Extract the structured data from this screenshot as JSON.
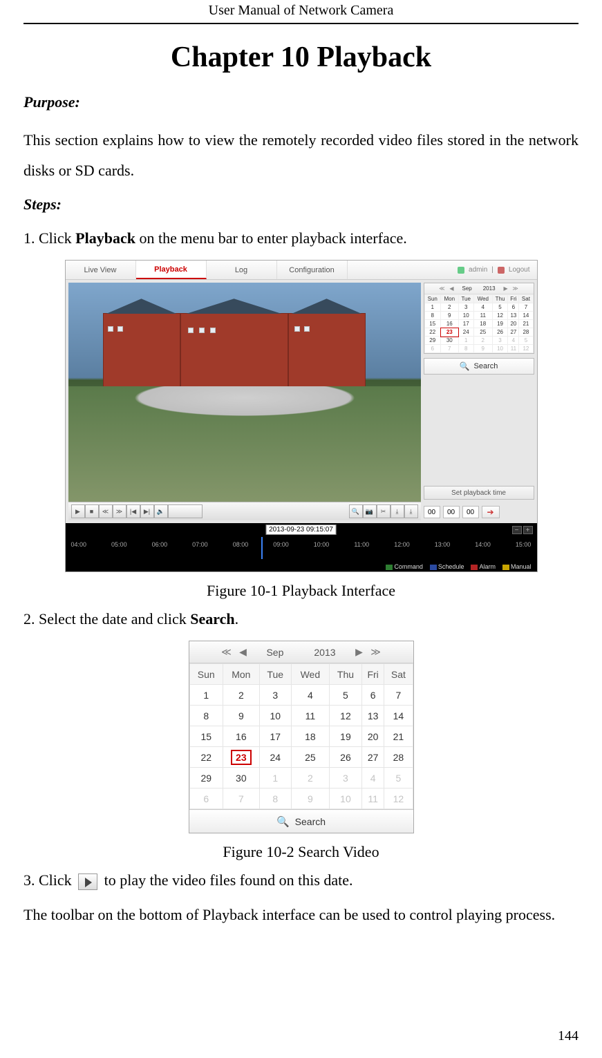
{
  "doc": {
    "header": "User Manual of Network Camera",
    "chapter_title": "Chapter 10  Playback",
    "purpose_label": "Purpose:",
    "purpose_text": "This section explains how to view the remotely recorded video files stored in the network disks or SD cards.",
    "steps_label": "Steps:",
    "step1": {
      "prefix": "1. Click ",
      "bold": "Playback",
      "suffix": " on the menu bar to enter playback interface."
    },
    "fig1_caption": "Figure 10-1 Playback Interface",
    "step2": {
      "prefix": "2. Select the date and click ",
      "bold": "Search",
      "suffix": "."
    },
    "fig2_caption": "Figure 10-2 Search Video",
    "step3": {
      "prefix": "3. Click ",
      "suffix": " to play the video files found on this date."
    },
    "toolbar_note": "The toolbar on the bottom of Playback interface can be used to control playing process.",
    "page_number": "144"
  },
  "fig1": {
    "tabs": [
      "Live View",
      "Playback",
      "Log",
      "Configuration"
    ],
    "user": {
      "name": "admin",
      "logout": "Logout"
    },
    "side": {
      "set_playback_label": "Set playback time",
      "time": {
        "hh": "00",
        "mm": "00",
        "ss": "00"
      }
    },
    "timeline": {
      "stamp": "2013-09-23 09:15:07",
      "hours": [
        "04:00",
        "05:00",
        "06:00",
        "07:00",
        "08:00",
        "09:00",
        "10:00",
        "11:00",
        "12:00",
        "13:00",
        "14:00",
        "15:00"
      ],
      "legend": [
        "Command",
        "Schedule",
        "Alarm",
        "Manual"
      ]
    }
  },
  "calendar": {
    "month": "Sep",
    "year": "2013",
    "dow": [
      "Sun",
      "Mon",
      "Tue",
      "Wed",
      "Thu",
      "Fri",
      "Sat"
    ],
    "selected": 23,
    "weeks": [
      [
        {
          "d": 1
        },
        {
          "d": 2
        },
        {
          "d": 3
        },
        {
          "d": 4
        },
        {
          "d": 5
        },
        {
          "d": 6
        },
        {
          "d": 7
        }
      ],
      [
        {
          "d": 8
        },
        {
          "d": 9
        },
        {
          "d": 10
        },
        {
          "d": 11
        },
        {
          "d": 12
        },
        {
          "d": 13
        },
        {
          "d": 14
        }
      ],
      [
        {
          "d": 15
        },
        {
          "d": 16
        },
        {
          "d": 17
        },
        {
          "d": 18
        },
        {
          "d": 19
        },
        {
          "d": 20
        },
        {
          "d": 21
        }
      ],
      [
        {
          "d": 22
        },
        {
          "d": 23
        },
        {
          "d": 24
        },
        {
          "d": 25
        },
        {
          "d": 26
        },
        {
          "d": 27
        },
        {
          "d": 28
        }
      ],
      [
        {
          "d": 29
        },
        {
          "d": 30
        },
        {
          "d": 1,
          "dim": true
        },
        {
          "d": 2,
          "dim": true
        },
        {
          "d": 3,
          "dim": true
        },
        {
          "d": 4,
          "dim": true
        },
        {
          "d": 5,
          "dim": true
        }
      ],
      [
        {
          "d": 6,
          "dim": true
        },
        {
          "d": 7,
          "dim": true
        },
        {
          "d": 8,
          "dim": true
        },
        {
          "d": 9,
          "dim": true
        },
        {
          "d": 10,
          "dim": true
        },
        {
          "d": 11,
          "dim": true
        },
        {
          "d": 12,
          "dim": true
        }
      ]
    ],
    "search_label": "Search"
  }
}
